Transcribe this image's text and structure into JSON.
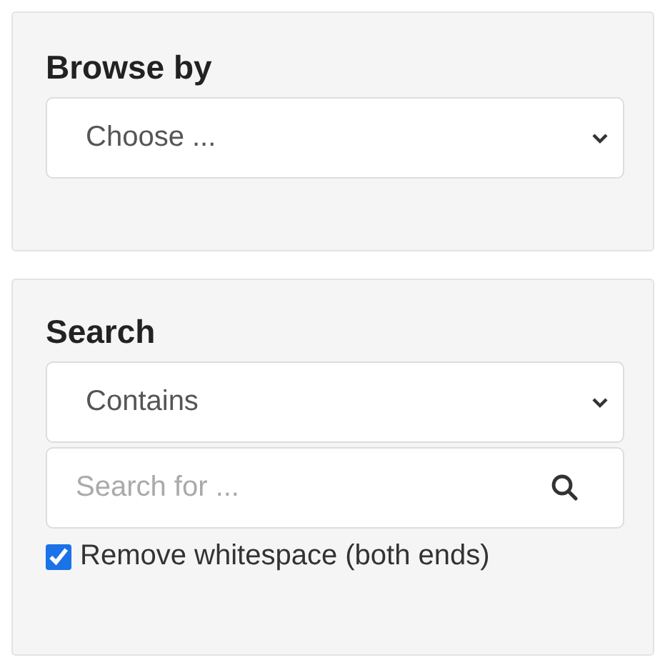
{
  "browse_panel": {
    "title": "Browse by",
    "select": {
      "value": "Choose ..."
    }
  },
  "search_panel": {
    "title": "Search",
    "mode_select": {
      "value": "Contains"
    },
    "search_field": {
      "placeholder": "Search for ..."
    },
    "options": [
      {
        "label": "Remove whitespace (both ends)",
        "checked": true
      }
    ]
  }
}
